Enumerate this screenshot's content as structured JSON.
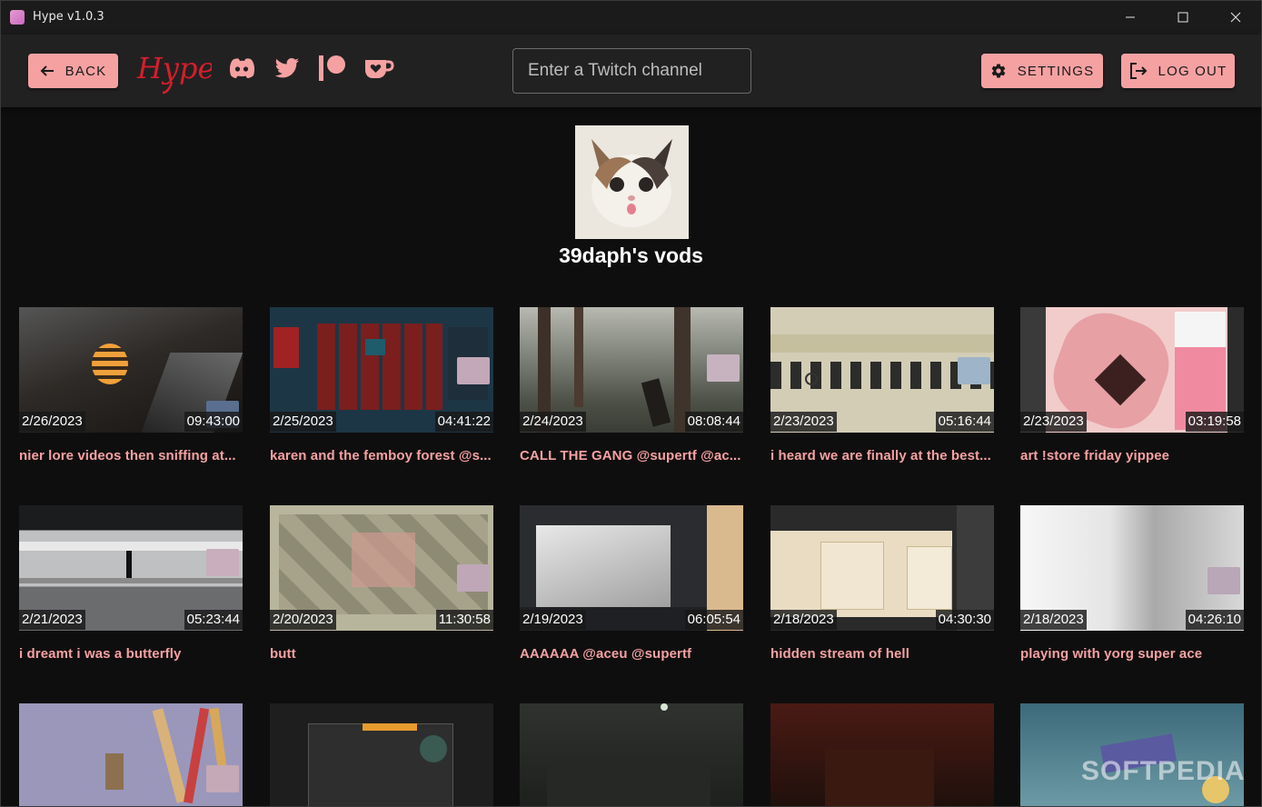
{
  "window": {
    "title": "Hype v1.0.3"
  },
  "toolbar": {
    "back_label": "BACK",
    "logo_text": "Hype",
    "search_placeholder": "Enter a Twitch channel",
    "settings_label": "SETTINGS",
    "logout_label": "LOG OUT",
    "accent": "#f5a1a2"
  },
  "channel": {
    "title": "39daph's vods"
  },
  "vods": [
    {
      "date": "2/26/2023",
      "duration": "09:43:00",
      "title": "nier lore videos then sniffing at..."
    },
    {
      "date": "2/25/2023",
      "duration": "04:41:22",
      "title": "karen and the femboy forest @s..."
    },
    {
      "date": "2/24/2023",
      "duration": "08:08:44",
      "title": "CALL THE GANG @supertf @ac..."
    },
    {
      "date": "2/23/2023",
      "duration": "05:16:44",
      "title": "i heard we are finally at the best..."
    },
    {
      "date": "2/23/2023",
      "duration": "03:19:58",
      "title": "art !store friday yippee"
    },
    {
      "date": "2/21/2023",
      "duration": "05:23:44",
      "title": "i dreamt i was a butterfly"
    },
    {
      "date": "2/20/2023",
      "duration": "11:30:58",
      "title": "butt"
    },
    {
      "date": "2/19/2023",
      "duration": "06:05:54",
      "title": "AAAAAA @aceu @supertf"
    },
    {
      "date": "2/18/2023",
      "duration": "04:30:30",
      "title": "hidden stream of hell"
    },
    {
      "date": "2/18/2023",
      "duration": "04:26:10",
      "title": "playing with yorg super ace"
    },
    {
      "date": "",
      "duration": "",
      "title": ""
    },
    {
      "date": "",
      "duration": "",
      "title": ""
    },
    {
      "date": "",
      "duration": "",
      "title": ""
    },
    {
      "date": "",
      "duration": "",
      "title": ""
    },
    {
      "date": "",
      "duration": "",
      "title": ""
    }
  ],
  "watermark": "SOFTPEDIA"
}
